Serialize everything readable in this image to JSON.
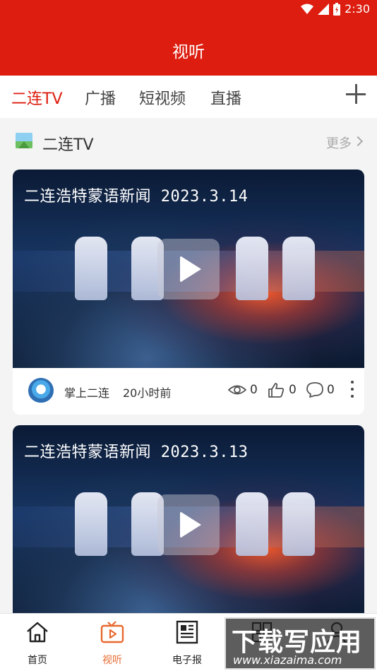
{
  "status_bar": {
    "time": "2:30"
  },
  "app_bar": {
    "title": "视听"
  },
  "tabs": [
    {
      "label": "二连TV",
      "active": true
    },
    {
      "label": "广播",
      "active": false
    },
    {
      "label": "短视频",
      "active": false
    },
    {
      "label": "直播",
      "active": false
    }
  ],
  "section": {
    "title": "二连TV",
    "more": "更多"
  },
  "videos": [
    {
      "title": "二连浩特蒙语新闻 2023.3.14",
      "source": "掌上二连",
      "time": "20小时前",
      "views": "0",
      "likes": "0",
      "comments": "0"
    },
    {
      "title": "二连浩特蒙语新闻 2023.3.13"
    }
  ],
  "bottom_nav": [
    {
      "label": "首页",
      "icon": "home-icon",
      "active": false
    },
    {
      "label": "视听",
      "icon": "tv-play-icon",
      "active": true
    },
    {
      "label": "电子报",
      "icon": "newspaper-icon",
      "active": false
    },
    {
      "label": "",
      "icon": "grid-icon",
      "active": false
    },
    {
      "label": "",
      "icon": "user-icon",
      "active": false
    }
  ],
  "colors": {
    "brand_red": "#dd1d0f",
    "active_orange": "#e8692e"
  },
  "watermark": {
    "text": "下载写应用",
    "url": "www.xiazaima.com"
  }
}
